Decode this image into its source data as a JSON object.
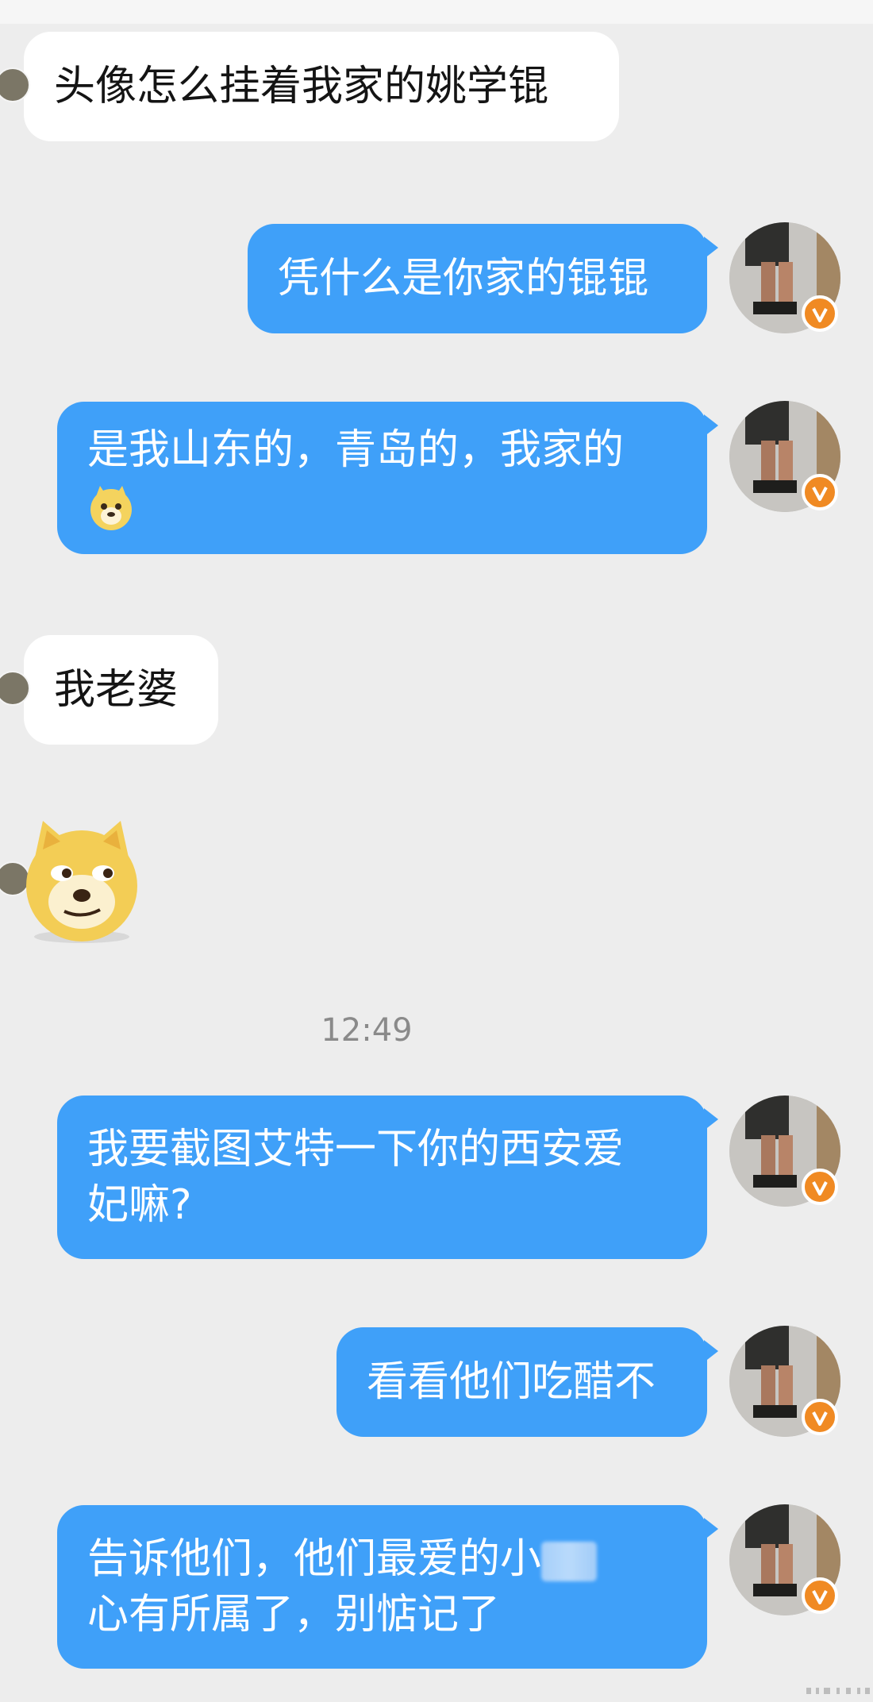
{
  "messages": [
    {
      "id": "m1",
      "side": "incoming",
      "lines": [
        "头像怎么挂着我家的姚学锟"
      ]
    },
    {
      "id": "m2",
      "side": "outgoing",
      "lines": [
        "凭什么是你家的锟锟"
      ]
    },
    {
      "id": "m3",
      "side": "outgoing",
      "lines": [
        "是我山东的，青岛的，我家的"
      ],
      "trailing_emoji": "doge-emoji"
    },
    {
      "id": "m4",
      "side": "incoming",
      "lines": [
        "我老婆"
      ]
    },
    {
      "id": "m5",
      "side": "incoming",
      "emoji": "doge-sticker"
    },
    {
      "id": "m6",
      "side": "outgoing",
      "lines": [
        "我要截图艾特一下你的西安爱",
        "妃嘛?"
      ]
    },
    {
      "id": "m7",
      "side": "outgoing",
      "lines": [
        "看看他们吃醋不"
      ]
    },
    {
      "id": "m8",
      "side": "outgoing",
      "lines": [
        "告诉他们，他们最爱的小",
        "心有所属了，别惦记了"
      ],
      "redacted_segment": true
    }
  ],
  "timestamp": "12:49",
  "colors": {
    "background": "#ededed",
    "incoming_bubble": "#ffffff",
    "outgoing_bubble": "#3fa0f9",
    "verified_badge": "#f08a23"
  },
  "icons": {
    "avatar": "user-avatar-icon",
    "badge": "verified-v-icon",
    "emoji": "doge-emoji"
  }
}
